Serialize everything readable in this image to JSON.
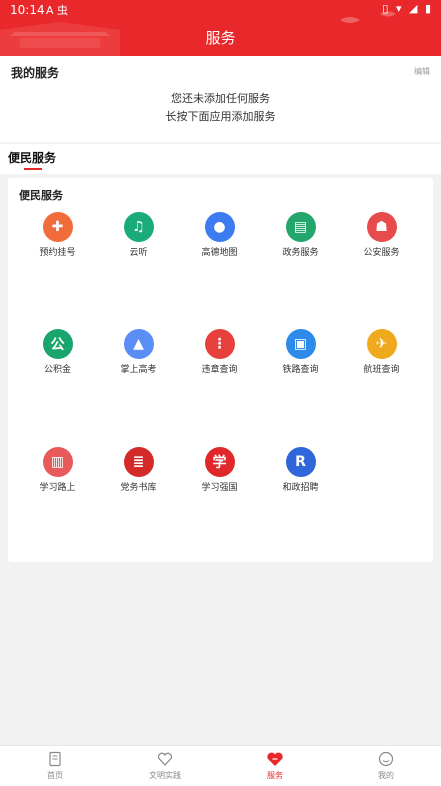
{
  "status_bar": {
    "time": "10:14",
    "left_icons": "A 虫",
    "right_icons": "▯ ▾ ◢ ▮"
  },
  "header": {
    "title": "服务",
    "color": "#e8282b"
  },
  "my_service": {
    "heading": "我的服务",
    "edit": "编辑",
    "empty_line1": "您还未添加任何服务",
    "empty_line2": "长按下面应用添加服务"
  },
  "convenience_tab": {
    "label": "便民服务"
  },
  "convenience_card": {
    "heading": "便民服务",
    "items": [
      {
        "label": "预约挂号",
        "icon": "nurse-icon",
        "color": "#f26b3a",
        "glyph": "✚"
      },
      {
        "label": "云听",
        "icon": "headphones-icon",
        "color": "#1aab7a",
        "glyph": "♫"
      },
      {
        "label": "高德地图",
        "icon": "map-pin-icon",
        "color": "#3d7cf0",
        "glyph": "●"
      },
      {
        "label": "政务服务",
        "icon": "chart-icon",
        "color": "#24a56b",
        "glyph": "▤"
      },
      {
        "label": "公安服务",
        "icon": "police-icon",
        "color": "#e84b4b",
        "glyph": "☗"
      },
      {
        "label": "公积金",
        "icon": "fund-icon",
        "color": "#1aa56e",
        "glyph": "公"
      },
      {
        "label": "掌上高考",
        "icon": "graduation-cap-icon",
        "color": "#5b8ef5",
        "glyph": "▲"
      },
      {
        "label": "违章查询",
        "icon": "traffic-light-icon",
        "color": "#e8413d",
        "glyph": "⋮"
      },
      {
        "label": "铁路查询",
        "icon": "train-icon",
        "color": "#2f8be8",
        "glyph": "▣"
      },
      {
        "label": "航班查询",
        "icon": "plane-icon",
        "color": "#f0a81c",
        "glyph": "✈"
      },
      {
        "label": "学习路上",
        "icon": "book-icon",
        "color": "#e85a5a",
        "glyph": "▥"
      },
      {
        "label": "党务书库",
        "icon": "books-icon",
        "color": "#d42a2a",
        "glyph": "≣"
      },
      {
        "label": "学习强国",
        "icon": "xuexi-logo-icon",
        "color": "#e0282b",
        "glyph": "学"
      },
      {
        "label": "和政招聘",
        "icon": "recruit-r-icon",
        "color": "#2f66d9",
        "glyph": "R"
      }
    ]
  },
  "tab_bar": {
    "tabs": [
      {
        "label": "首页",
        "icon": "home-doc-icon",
        "active": false
      },
      {
        "label": "文明实践",
        "icon": "heart-icon",
        "active": false
      },
      {
        "label": "服务",
        "icon": "service-heart-icon",
        "active": true
      },
      {
        "label": "我的",
        "icon": "smile-icon",
        "active": false
      }
    ]
  }
}
